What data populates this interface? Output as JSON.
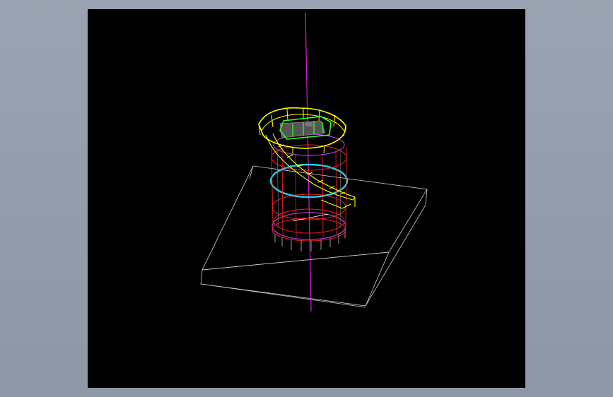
{
  "viewport": {
    "background": "#000000",
    "canvas_background": "#8f99a8"
  },
  "model": {
    "description_colors": {
      "axis": "#d21fd2",
      "platform_railing": "#ffff00",
      "inner_railing": "#33ff33",
      "stair": "#ffff00",
      "shell_frame": "#ff2020",
      "ring_band": "#22ccee",
      "base_ring": "#b040d0",
      "ground_box": "#cfcfcf",
      "legs": "#aaaaaa"
    }
  }
}
